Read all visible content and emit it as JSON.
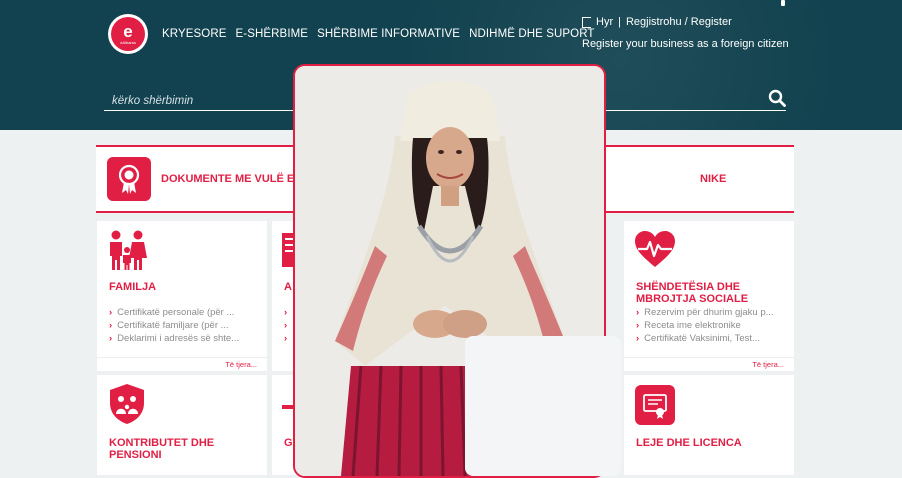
{
  "brand": {
    "logo_letter": "e",
    "logo_sub": "eAlbania"
  },
  "nav": [
    "KRYESORE",
    "E-SHËRBIME",
    "SHËRBIME INFORMATIVE",
    "NDIHMË DHE SUPORT"
  ],
  "account": {
    "login": "Hyr",
    "separator": "|",
    "register": "Regjistrohu / Register",
    "foreign": "Register your business as a foreign citizen"
  },
  "search": {
    "placeholder": "kërko shërbimin"
  },
  "documents_banner": {
    "title_start": "DOKUMENTE ME VULË EL",
    "title_end": "NIKE"
  },
  "cards": {
    "family": {
      "title": "FAMILJA",
      "links": [
        "Certifikatë personale (për ...",
        "Certifikatë familjare (për ...",
        "Deklarimi i adresës së shte..."
      ],
      "more": "Të tjera..."
    },
    "second": {
      "title": "A",
      "links": [
        "",
        "",
        ""
      ]
    },
    "health": {
      "title_line1": "SHËNDETËSIA DHE",
      "title_line2": "MBROJTJA SOCIALE",
      "links": [
        "Rezervim për dhurim gjaku p...",
        "Receta ime elektronike",
        "Certifikatë Vaksinimi, Test..."
      ],
      "more": "Të tjera..."
    },
    "pension": {
      "title_line1": "KONTRIBUTET DHE",
      "title_line2": "PENSIONI"
    },
    "middle_bottom": {
      "title": "G"
    },
    "license": {
      "title": "LEJE DHE LICENCA"
    }
  },
  "colors": {
    "header_bg": "#12424f",
    "accent": "#e11f45",
    "page_bg": "#eef1f2"
  }
}
